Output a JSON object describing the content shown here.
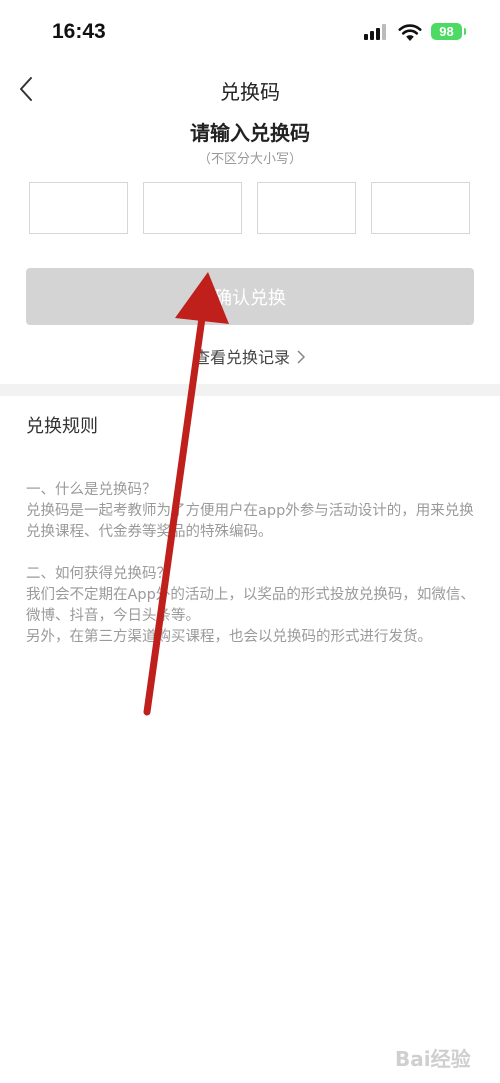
{
  "status_bar": {
    "time": "16:43",
    "battery": "98"
  },
  "nav": {
    "title": "兑换码",
    "back_icon": "chevron-left-icon"
  },
  "redeem": {
    "title": "请输入兑换码",
    "subtitle": "（不区分大小写）",
    "code_slots": 4,
    "confirm_label": "确认兑换",
    "record_link": "查看兑换记录"
  },
  "rules": {
    "title": "兑换规则",
    "paragraphs": [
      "一、什么是兑换码？",
      "兑换码是一起考教师为了方便用户在app外参与活动设计的，用来兑换兑换课程、代金券等奖品的特殊编码。",
      "二、如何获得兑换码？",
      "我们会不定期在App外的活动上，以奖品的形式投放兑换码，如微信、微博、抖音，今日头条等。",
      "另外，在第三方渠道购买课程，也会以兑换码的形式进行发货。"
    ]
  },
  "watermark": {
    "text": "Bai经验"
  },
  "colors": {
    "button_disabled": "#d4d4d4",
    "annotation_arrow": "#c0201c",
    "battery": "#4cd964"
  }
}
